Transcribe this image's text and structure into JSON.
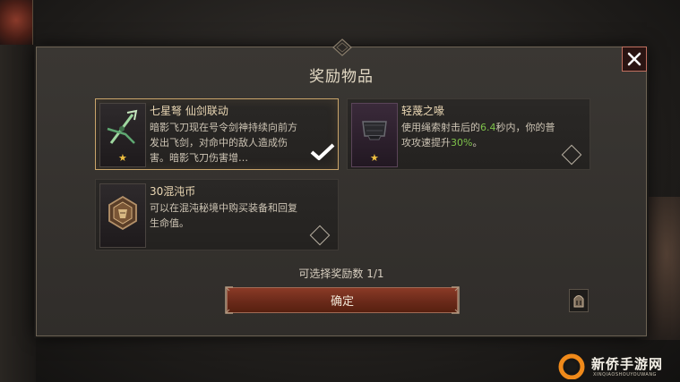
{
  "dialog": {
    "title": "奖励物品",
    "selection_count": "可选择奖励数 1/1",
    "confirm_label": "确定"
  },
  "rewards": [
    {
      "name": "七星弩 仙剑联动",
      "description": "暗影飞刀现在号令剑神持续向前方发出飞剑，对命中的敌人造成伤害。暗影飞刀伤害增…",
      "rarity_icon": "star-icon",
      "selected": true
    },
    {
      "name": "轻蔑之喙",
      "desc_prefix": "使用绳索射击后的",
      "desc_highlight1": "6.4",
      "desc_mid": "秒内，你的普攻攻速提升",
      "desc_highlight2": "30%",
      "desc_suffix": "。",
      "rarity_icon": "star-icon",
      "selected": false
    },
    {
      "name": "30混沌币",
      "description": "可以在混沌秘境中购买装备和回复生命值。",
      "selected": false
    }
  ],
  "watermark": {
    "text": "新侨手游网",
    "subtext": "XINQIAOSHOUYOUWANG"
  },
  "colors": {
    "highlight": "#7ec24a",
    "selected_border": "#c9a46a",
    "confirm_button": "#7a3220"
  }
}
